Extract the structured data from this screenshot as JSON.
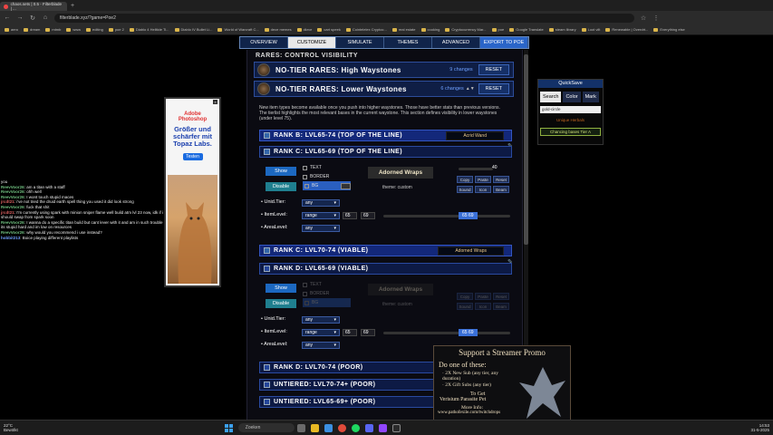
{
  "browser": {
    "tab_title": "chaos.sets | 0.5 - Filterblade | ...",
    "url": "filterblade.xyz/?game=Poe2",
    "bookmarks": [
      "aero",
      "dream",
      "mtmb",
      "www",
      "editing",
      "poe 2",
      "Diablo 4 Helltide Ti...",
      "Diablo IV Bullet Li...",
      "World of Warcraft C...",
      "dece memes",
      "dkrve",
      "cart speek",
      "Cointelelex Cryptoc...",
      "real estate",
      "cooking",
      "Cryptocurrency Mar...",
      "poe",
      "Google Translate",
      "steam library",
      "Loot vilt",
      "Renewable | Overdrt...",
      "Everything else"
    ]
  },
  "nav": {
    "items": [
      "OVERVIEW",
      "CUSTOMIZE",
      "SIMULATE",
      "THEMES",
      "ADVANCED",
      "EXPORT TO POE"
    ],
    "active": "CUSTOMIZE"
  },
  "main": {
    "section_title": "RARES: CONTROL VISIBILITY",
    "high_waystones": {
      "label": "NO-TIER RARES: High Waystones",
      "changes": "9 changes",
      "reset": "RESET"
    },
    "lower_waystones": {
      "label": "NO-TIER RARES: Lower Waystones",
      "changes": "6 changes",
      "reset": "RESET"
    },
    "info": "New item types become available once you push into higher waystones. Those have better stats than previous versions. The tierlist highlights the most relevant bases in the current waystone. This section defines visibility in lower waystones (under level 75).",
    "rank_b": {
      "label": "RANK B: LVL65-74 (TOP OF THE LINE)",
      "tag": "Acrid Wand"
    },
    "rank_c": {
      "label": "RANK C: LVL65-69 (TOP OF THE LINE)"
    },
    "rank_c2": {
      "label": "RANK C: LVL70-74 (VIABLE)",
      "tag": "Adorned Wraps"
    },
    "rank_d1": {
      "label": "RANK D: LVL65-69 (VIABLE)"
    },
    "rank_d2": {
      "label": "RANK D: LVL70-74 (POOR)"
    },
    "untiered1": {
      "label": "UNTIERED: LVL70-74+ (POOR)"
    },
    "untiered2": {
      "label": "UNTIERED: LVL65-69+ (POOR)"
    },
    "editor1": {
      "show": "Show",
      "disable": "Disable",
      "checks": [
        "TEXT",
        "BORDER",
        "BG"
      ],
      "preview": "Adorned Wraps",
      "theme": "theme: custom",
      "size_value": "40",
      "buttons": [
        "Copy",
        "Paste",
        "Reset",
        "Sound",
        "Icon",
        "Beam"
      ],
      "unid_label": "Unid.Tier:",
      "unid_value": "any",
      "ilvl_label": "ItemLevel:",
      "ilvl_op": "range",
      "ilvl_min": "65",
      "ilvl_max": "69",
      "ilvl_slider": "65 69",
      "area_label": "AreaLevel:",
      "area_value": "any"
    },
    "editor2": {
      "show": "Show",
      "disable": "Disable",
      "checks": [
        "TEXT",
        "BORDER",
        "BG"
      ],
      "preview": "Adorned Wraps",
      "theme": "theme: custom",
      "buttons": [
        "Copy",
        "Paste",
        "Reset",
        "Sound",
        "Icon",
        "Beam"
      ],
      "unid_label": "Unid.Tier:",
      "unid_value": "any",
      "ilvl_label": "ItemLevel:",
      "ilvl_op": "range",
      "ilvl_min": "65",
      "ilvl_max": "69",
      "ilvl_slider": "65 69",
      "area_label": "AreaLevel:",
      "area_value": "any"
    }
  },
  "quicksave": {
    "title": "QuickSave",
    "tabs": [
      "Search",
      "Color",
      "Mark"
    ],
    "search_value": "gold-circle",
    "line1": "Unique Herbals",
    "line2": "Chancing bases Tier A"
  },
  "chat": [
    {
      "user": "",
      "msg": "you"
    },
    {
      "user": "ReevVoor26",
      "msg": "am a titan with a staff"
    },
    {
      "user": "ReevVoor26",
      "msg": "ohh well"
    },
    {
      "user": "ReevVoor26",
      "msg": "I wont touch stupid maces"
    },
    {
      "user": "jrcdt21",
      "msg": "i've not tried the druid earth spell thing you used it did look strong"
    },
    {
      "user": "ReevVoor26",
      "msg": "fuck that shit"
    },
    {
      "user": "jrcdt21",
      "msg": "I'm currently using spark with minion sniper flame well build atm lvl 23 now, idk if i should swap from spark soon"
    },
    {
      "user": "ReevVoor26",
      "msg": "I wanna do a specific titan build but cant lever with it and am in such trouble its stupid hard and im low on resources"
    },
    {
      "user": "ReevVoor26",
      "msg": "why would you recommend i use instead?"
    },
    {
      "user": "hobbit213",
      "msg": "Boice playing different playlists"
    }
  ],
  "ad": {
    "brand": "Adobe",
    "product": "Photoshop",
    "headline": "Größer und schärfer mit Topaz Labs.",
    "cta": "Testen"
  },
  "promo": {
    "title": "Support a Streamer Promo",
    "do_one": "Do one of these:",
    "lines": [
      "2X New Sub (any tier, any duration)",
      "2X Gift Subs (any tier)"
    ],
    "get": "To Get",
    "reward": "Verisium Parasite Pet",
    "more": "More Info:",
    "url": "www.pathofexile.com/twitchdrops"
  },
  "taskbar": {
    "weather": "22°C",
    "weather_sub": "Bewölkt",
    "search": "Zoeken",
    "time": "14:53",
    "date": "31-5-2025"
  }
}
